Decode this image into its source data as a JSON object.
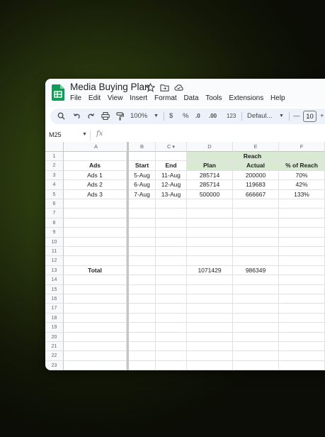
{
  "doc": {
    "title": "Media Buying Plan"
  },
  "menu": [
    "File",
    "Edit",
    "View",
    "Insert",
    "Format",
    "Data",
    "Tools",
    "Extensions",
    "Help"
  ],
  "toolbar": {
    "zoom": "100%",
    "currency": "$",
    "percent": "%",
    "decrease_decimal": ".0",
    "increase_decimal": ".00",
    "number_format": "123",
    "font": "Defaul...",
    "font_size": "10",
    "minus": "—",
    "plus": "+"
  },
  "formula_bar": {
    "name_box": "M25",
    "fx": "fx"
  },
  "columns": [
    "A",
    "B",
    "C",
    "D",
    "E",
    "F"
  ],
  "rows": [
    "1",
    "2",
    "3",
    "4",
    "5",
    "6",
    "7",
    "8",
    "9",
    "10",
    "11",
    "12",
    "13",
    "14",
    "15",
    "16",
    "17",
    "18",
    "19",
    "20",
    "21",
    "22",
    "23"
  ],
  "sheet": {
    "reach_header": "Reach",
    "headers": {
      "ads": "Ads",
      "start": "Start",
      "end": "End",
      "plan": "Plan",
      "actual": "Actual",
      "pct": "% of Reach"
    },
    "data_rows": [
      {
        "ads": "Ads 1",
        "start": "5-Aug",
        "end": "11-Aug",
        "plan": "285714",
        "actual": "200000",
        "pct": "70%"
      },
      {
        "ads": "Ads 2",
        "start": "6-Aug",
        "end": "12-Aug",
        "plan": "285714",
        "actual": "119683",
        "pct": "42%"
      },
      {
        "ads": "Ads 3",
        "start": "7-Aug",
        "end": "13-Aug",
        "plan": "500000",
        "actual": "666667",
        "pct": "133%"
      }
    ],
    "total": {
      "label": "Total",
      "plan": "1071429",
      "actual": "986349"
    }
  },
  "colors": {
    "header_green": "#d9ead3",
    "sheets_green": "#0f9d58",
    "toolbar_bg": "#edf2fa"
  }
}
